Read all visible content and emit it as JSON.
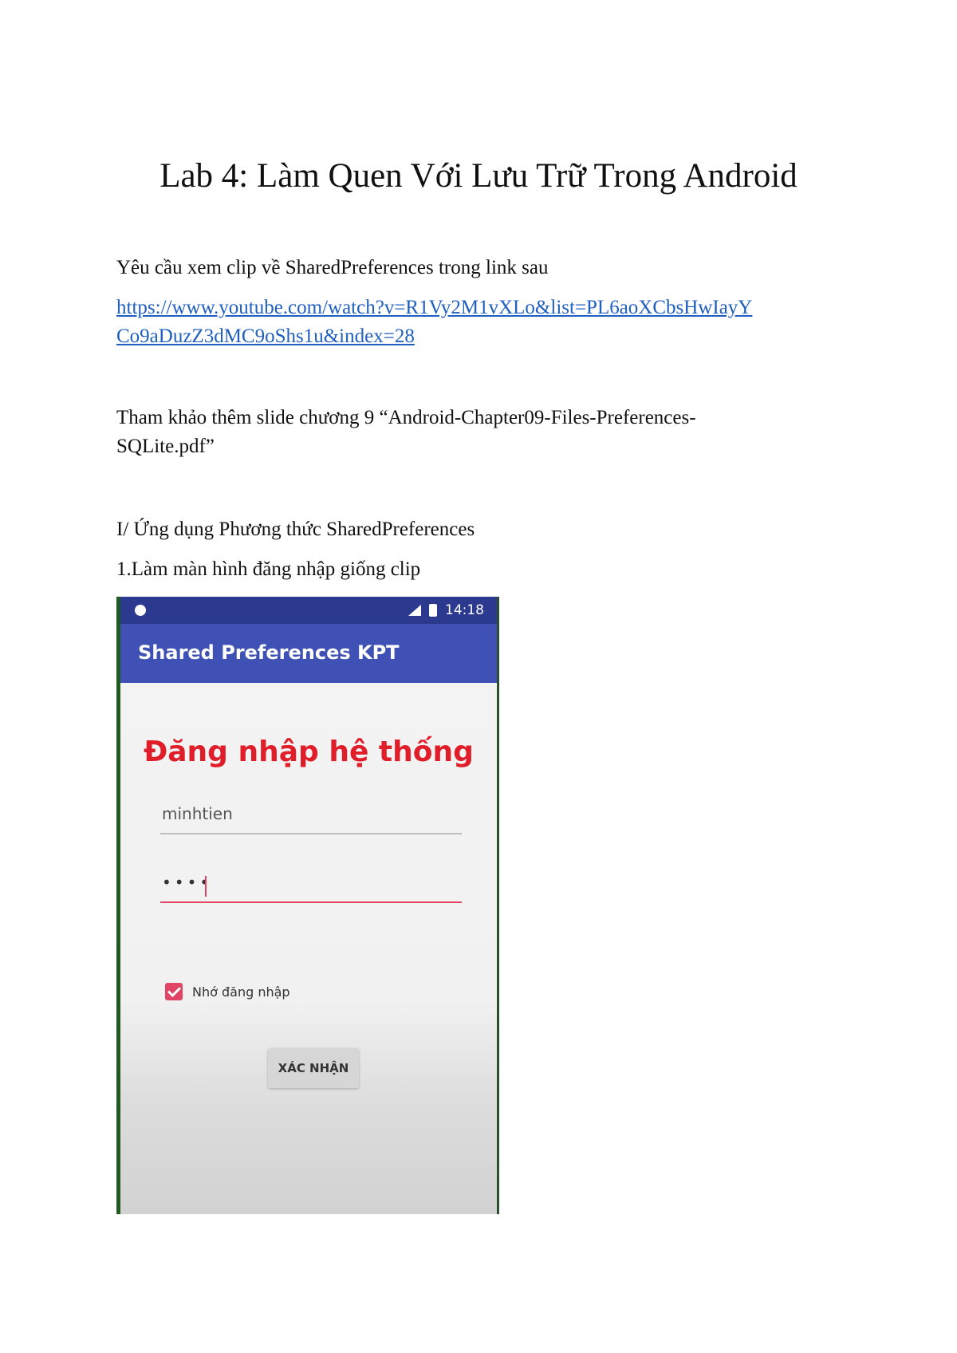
{
  "document": {
    "title": "Lab 4: Làm Quen Với Lưu Trữ Trong Android",
    "intro": "Yêu cầu xem clip về SharedPreferences trong link sau",
    "link_line1": "https://www.youtube.com/watch?v=R1Vy2M1vXLo&list=PL6aoXCbsHwIayY",
    "link_line2": "Co9aDuzZ3dMC9oShs1u&index=28",
    "reference_line1": "Tham khảo thêm slide chương 9 “Android-Chapter09-Files-Preferences-",
    "reference_line2": "SQLite.pdf”",
    "section_heading": "I/ Ứng dụng Phương thức SharedPreferences",
    "step_1": "1.Làm màn hình đăng nhập giống clip"
  },
  "phone": {
    "status_time": "14:18",
    "app_title": "Shared Preferences KPT",
    "login_heading": "Đăng nhập hệ thống",
    "username_value": "minhtien",
    "password_value": "••••",
    "remember_label": "Nhớ đăng nhập",
    "remember_checked": true,
    "confirm_button": "XÁC NHẬN",
    "colors": {
      "status_bar": "#2b3a8f",
      "app_bar": "#3f51b5",
      "heading": "#e01e2a",
      "accent": "#e04566"
    }
  }
}
